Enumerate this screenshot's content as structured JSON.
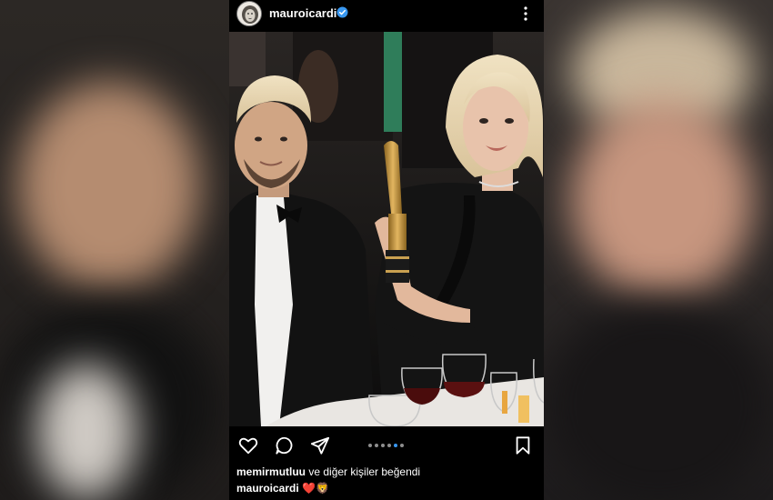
{
  "post": {
    "username": "mauroicardi",
    "verified": true,
    "more_icon": "more-vertical-icon"
  },
  "actions": {
    "like_icon": "heart-icon",
    "comment_icon": "comment-icon",
    "share_icon": "send-icon",
    "save_icon": "bookmark-icon",
    "carousel_count": 5,
    "carousel_active_index": 4
  },
  "likes": {
    "liker": "memirmutluu",
    "suffix": "ve diğer kişiler beğendi"
  },
  "caption": {
    "username": "mauroicardi",
    "text": "❤️🦁"
  },
  "colors": {
    "verified_blue": "#3897f0",
    "carousel_active": "#3897f0",
    "background": "#000000"
  }
}
